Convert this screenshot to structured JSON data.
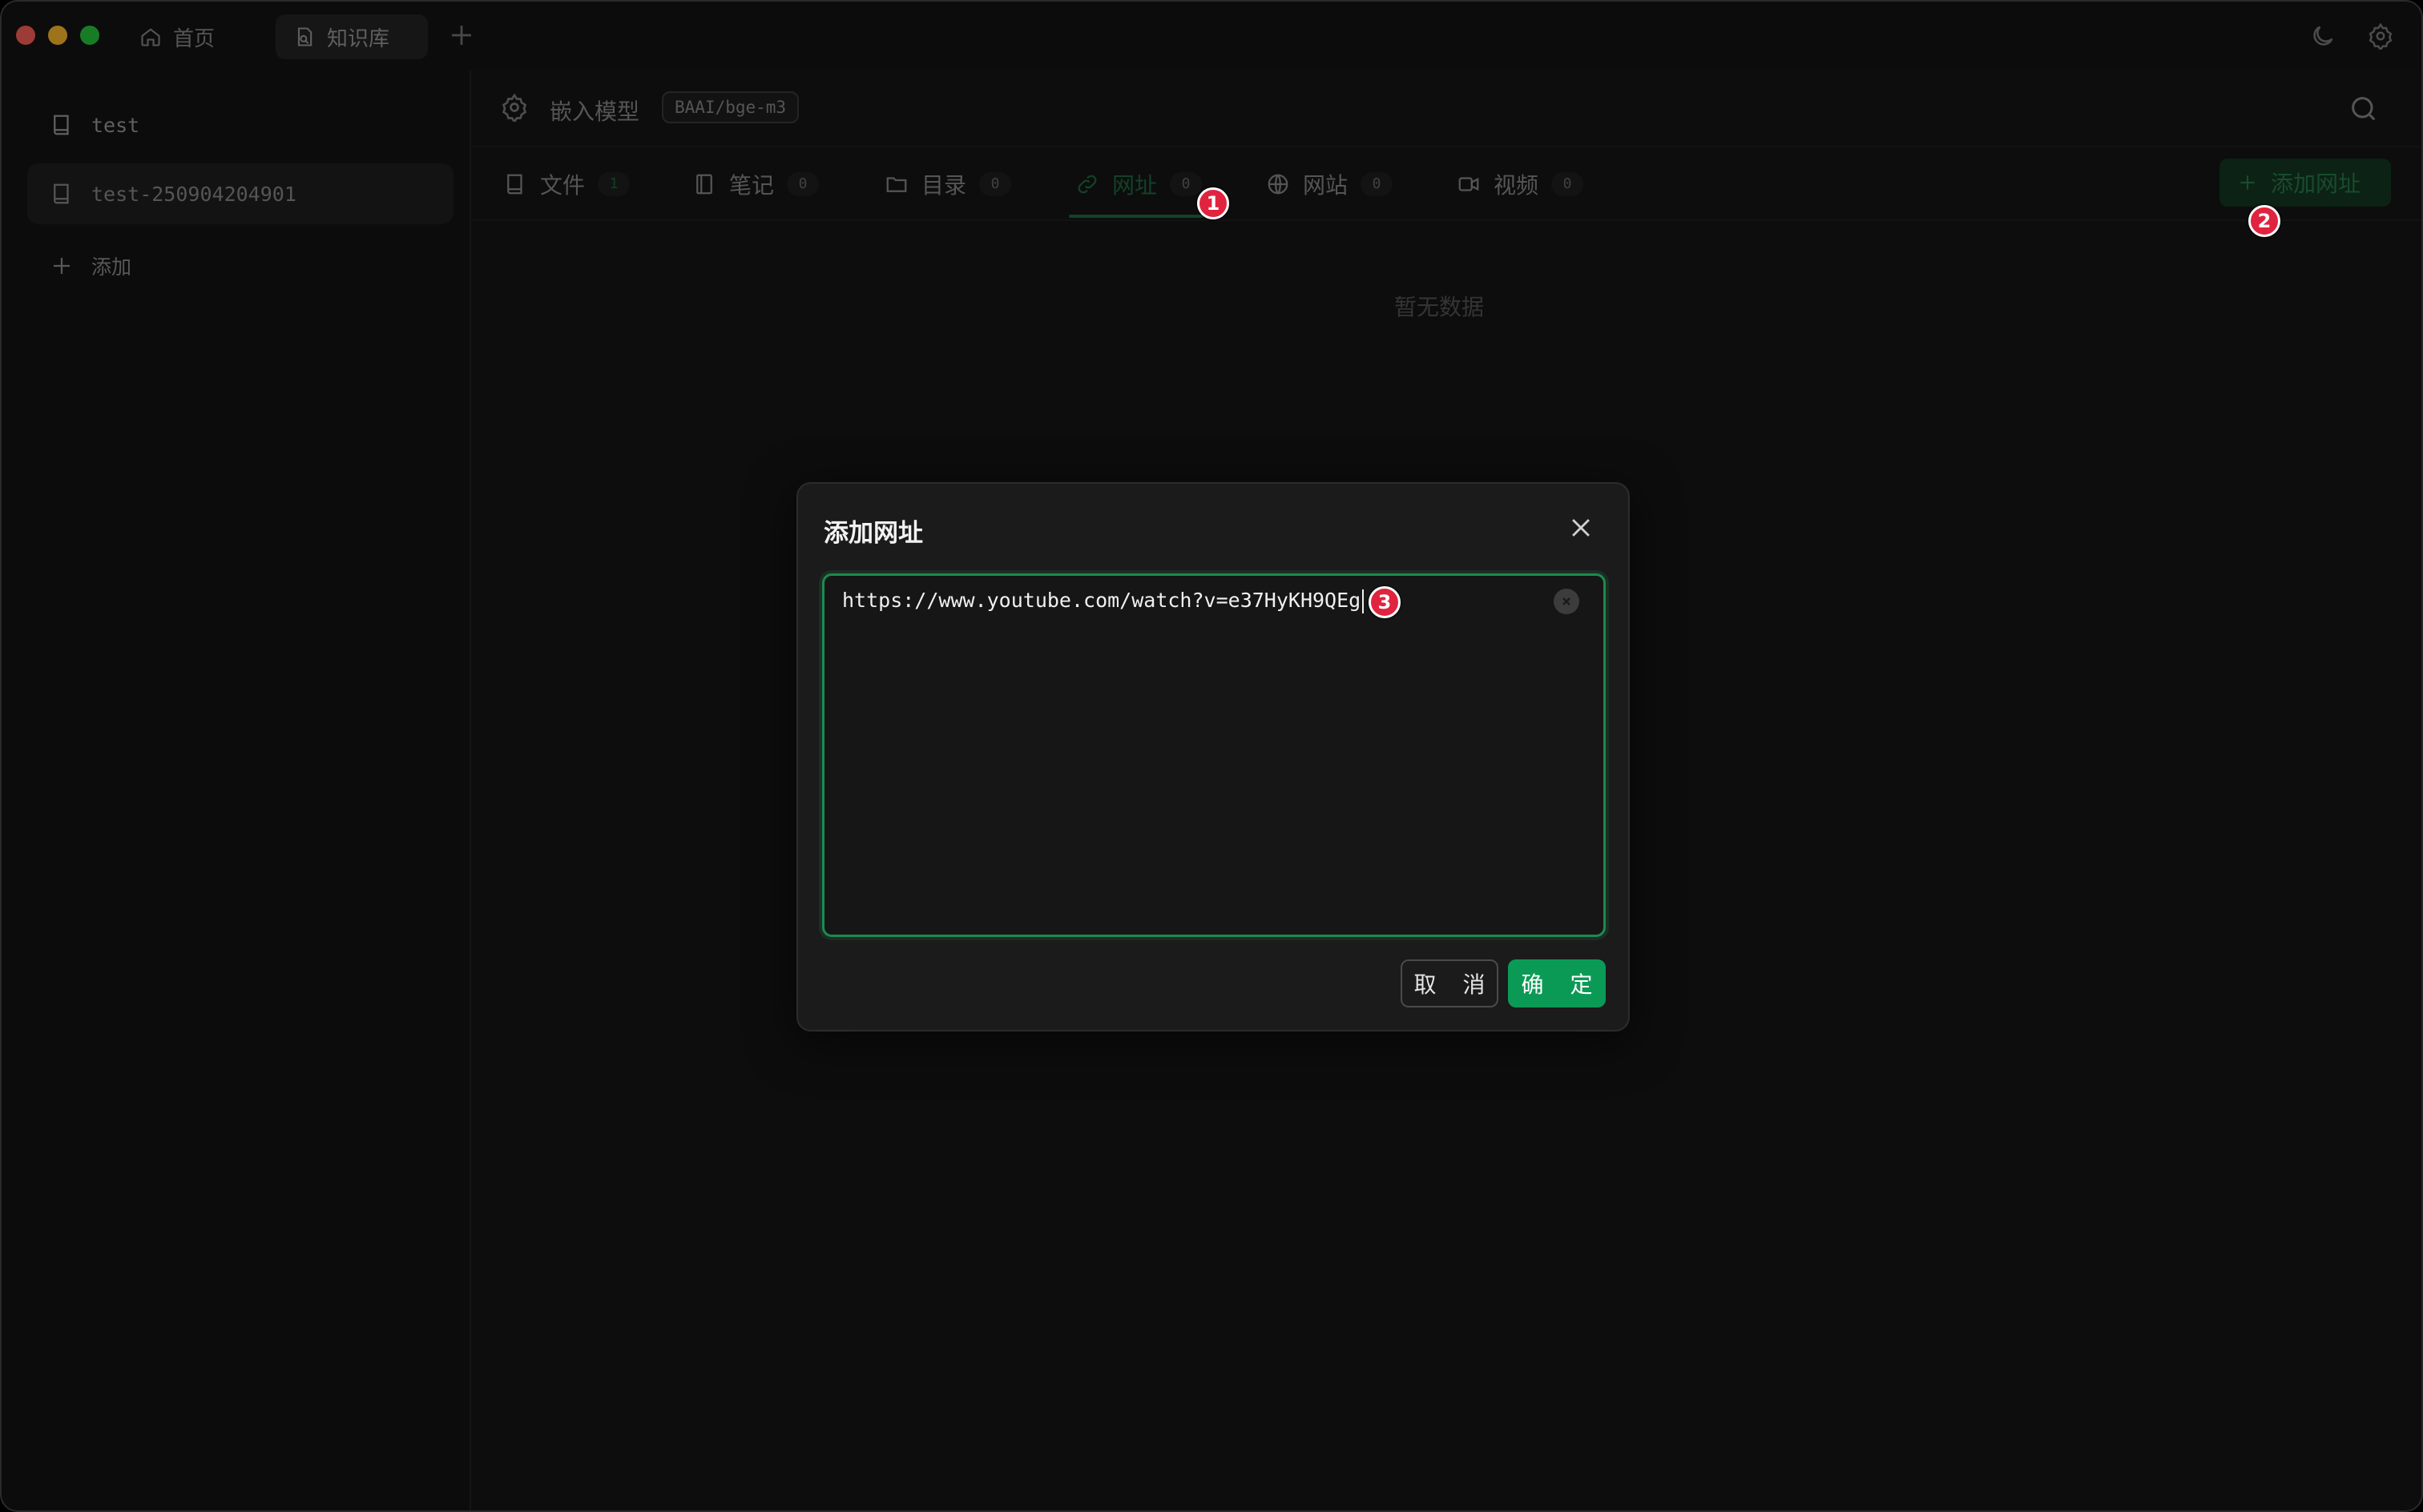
{
  "titlebar": {
    "tabs": [
      {
        "label": "首页",
        "icon": "home-icon"
      },
      {
        "label": "知识库",
        "icon": "knowledge-icon"
      }
    ]
  },
  "sidebar": {
    "items": [
      {
        "label": "test",
        "icon": "book-icon"
      },
      {
        "label": "test-250904204901",
        "icon": "book-icon",
        "active": true
      },
      {
        "label": "添加",
        "icon": "plus-icon"
      }
    ]
  },
  "main": {
    "embedding": {
      "label": "嵌入模型",
      "model": "BAAI/bge-m3"
    },
    "tabs": [
      {
        "label": "文件",
        "count": "1"
      },
      {
        "label": "笔记",
        "count": "0"
      },
      {
        "label": "目录",
        "count": "0"
      },
      {
        "label": "网址",
        "count": "0",
        "active": true
      },
      {
        "label": "网站",
        "count": "0"
      },
      {
        "label": "视频",
        "count": "0"
      }
    ],
    "add_button": "添加网址",
    "empty_text": "暂无数据"
  },
  "markers": [
    "1",
    "2",
    "3"
  ],
  "dialog": {
    "title": "添加网址",
    "url_value": "https://www.youtube.com/watch?v=e37HyKH9QEg",
    "cancel_label": "取 消",
    "ok_label": "确 定"
  },
  "colors": {
    "accent": "#0b9a56",
    "marker": "#e0243f",
    "background": "#161616"
  }
}
